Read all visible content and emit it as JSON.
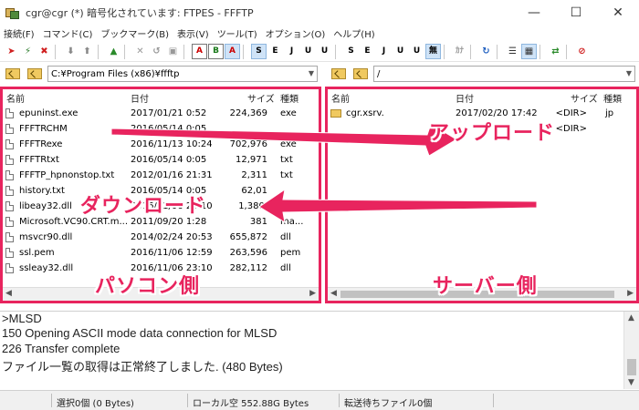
{
  "window": {
    "title": "cgr@cgr (*) 暗号化されています: FTPES - FFFTP",
    "minimize_icon": "minimize-icon",
    "maximize_icon": "maximize-icon",
    "close_icon": "close-icon"
  },
  "menu": [
    "接続(F)",
    "コマンド(C)",
    "ブックマーク(B)",
    "表示(V)",
    "ツール(T)",
    "オプション(O)",
    "ヘルプ(H)"
  ],
  "toolbar": {
    "mode_buttons": [
      "A",
      "B",
      "A"
    ],
    "kanji_buttons": [
      "S",
      "E",
      "J",
      "U",
      "U",
      "無"
    ],
    "kanji_buttons_2": [
      "S",
      "E",
      "J",
      "U",
      "U",
      "無"
    ],
    "kana_button": "ｶﾅ"
  },
  "left_panel": {
    "path": "C:¥Program Files (x86)¥ffftp",
    "columns": [
      "名前",
      "日付",
      "サイズ",
      "種類"
    ],
    "files": [
      {
        "name": "epuninst.exe",
        "date": "2017/01/21 0:52",
        "size": "224,369",
        "type": "exe"
      },
      {
        "name": "FFFTRCHM",
        "date": "2016/05/14 0:05",
        "size": "",
        "type": ""
      },
      {
        "name": "FFFTRexe",
        "date": "2016/11/13 10:24",
        "size": "702,976",
        "type": "exe"
      },
      {
        "name": "FFFTRtxt",
        "date": "2016/05/14 0:05",
        "size": "12,971",
        "type": "txt"
      },
      {
        "name": "FFFTP_hpnonstop.txt",
        "date": "2012/01/16 21:31",
        "size": "2,311",
        "type": "txt"
      },
      {
        "name": "history.txt",
        "date": "2016/05/14 0:05",
        "size": "62,01",
        "type": ""
      },
      {
        "name": "libeay32.dll",
        "date": "2016/11/06 23:10",
        "size": "1,380,",
        "type": ""
      },
      {
        "name": "Microsoft.VC90.CRT.m...",
        "date": "2011/09/20 1:28",
        "size": "381",
        "type": "ma..."
      },
      {
        "name": "msvcr90.dll",
        "date": "2014/02/24 20:53",
        "size": "655,872",
        "type": "dll"
      },
      {
        "name": "ssl.pem",
        "date": "2016/11/06 12:59",
        "size": "263,596",
        "type": "pem"
      },
      {
        "name": "ssleay32.dll",
        "date": "2016/11/06 23:10",
        "size": "282,112",
        "type": "dll"
      }
    ]
  },
  "right_panel": {
    "path": "/",
    "columns": [
      "名前",
      "日付",
      "サイズ",
      "種類"
    ],
    "files": [
      {
        "name": "cgr.xsrv.",
        "date": "2017/02/20 17:42",
        "size": "<DIR>",
        "type": "jp"
      },
      {
        "name": "",
        "date": "",
        "size": "<DIR>",
        "type": ""
      }
    ]
  },
  "log": [
    ">MLSD",
    "150 Opening ASCII mode data connection for MLSD",
    "226 Transfer complete",
    "ファイル一覧の取得は正常終了しました. (480 Bytes)"
  ],
  "status": {
    "selection": "選択0個 (0 Bytes)",
    "local_free": "ローカル空 552.88G Bytes",
    "queue": "転送待ちファイル0個"
  },
  "annotations": {
    "upload": "アップロード",
    "download": "ダウンロード",
    "pc_side": "パソコン側",
    "server_side": "サーバー側",
    "color": "#e8245e"
  }
}
